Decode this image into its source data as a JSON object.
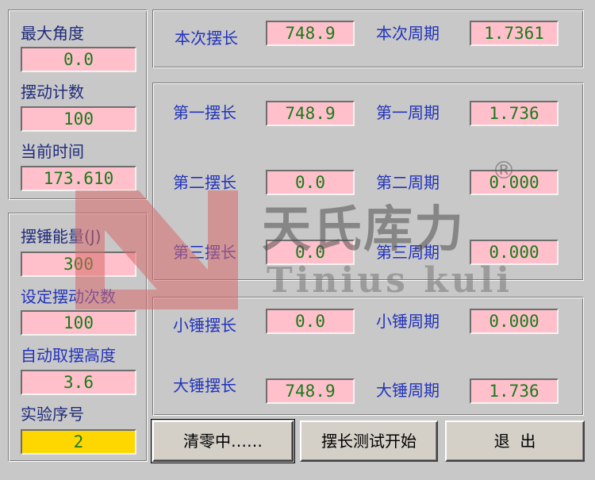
{
  "left_top": {
    "max_angle": {
      "label": "最大角度",
      "value": "0.0"
    },
    "swing_count": {
      "label": "摆动计数",
      "value": "100"
    },
    "current_time": {
      "label": "当前时间",
      "value": "173.610"
    }
  },
  "left_bottom": {
    "hammer_energy": {
      "label": "摆锤能量(J)",
      "value": "300"
    },
    "set_swing_count": {
      "label": "设定摆动次数",
      "value": "100"
    },
    "auto_height": {
      "label": "自动取摆高度",
      "value": "3.6"
    },
    "sample_no": {
      "label": "实验序号",
      "value": "2"
    }
  },
  "current": {
    "length_label": "本次摆长",
    "length_value": "748.9",
    "period_label": "本次周期",
    "period_value": "1.7361"
  },
  "measurements": [
    {
      "length_label": "第一摆长",
      "length_value": "748.9",
      "period_label": "第一周期",
      "period_value": "1.736"
    },
    {
      "length_label": "第二摆长",
      "length_value": "0.0",
      "period_label": "第二周期",
      "period_value": "0.000"
    },
    {
      "length_label": "第三摆长",
      "length_value": "0.0",
      "period_label": "第三周期",
      "period_value": "0.000"
    }
  ],
  "hammers": {
    "small": {
      "length_label": "小锤摆长",
      "length_value": "0.0",
      "period_label": "小锤周期",
      "period_value": "0.000"
    },
    "large": {
      "length_label": "大锤摆长",
      "length_value": "748.9",
      "period_label": "大锤周期",
      "period_value": "1.736"
    }
  },
  "buttons": {
    "zero": "清零中……",
    "start_test": "摆长测试开始",
    "exit": "退  出"
  },
  "watermark": {
    "brand_cn": "天氏库力",
    "brand_en": "Tinius kuli",
    "registered": "®"
  },
  "colors": {
    "background": "#c8c8c8",
    "field_pink": "#ffc0cb",
    "field_yellow": "#ffd700",
    "value_green": "#1a7a1a",
    "label_blue": "#2233bb"
  }
}
